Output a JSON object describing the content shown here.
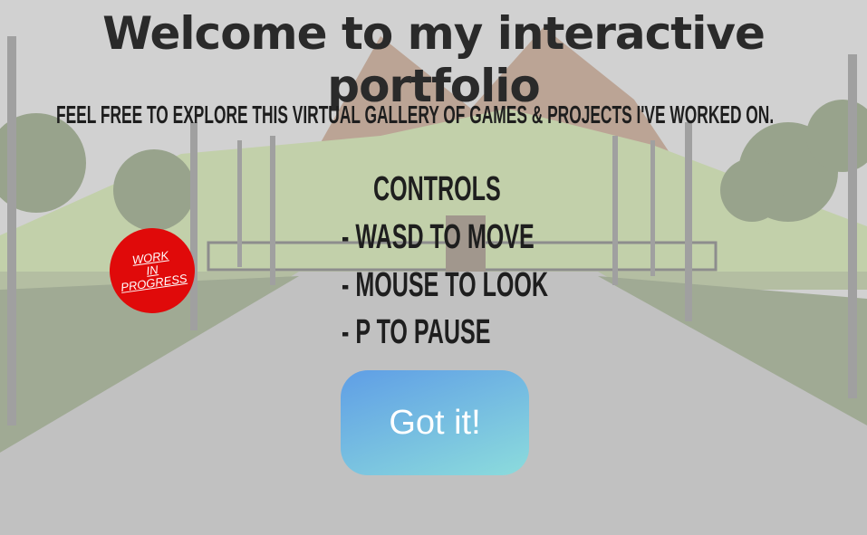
{
  "title": "Welcome to my interactive portfolio",
  "subtitle": "Feel free to explore this virtual gallery of games & projects I've worked on.",
  "controls": {
    "heading": "Controls",
    "items": [
      "- WASD to move",
      "- Mouse to look",
      "- P to pause"
    ]
  },
  "button": {
    "label": "Got it!",
    "gradient": [
      "#5f9ee6",
      "#8cdcdc"
    ]
  },
  "badge": {
    "lines": [
      "WORK",
      "IN",
      "PROGRESS"
    ],
    "color": "#e00a0a"
  }
}
